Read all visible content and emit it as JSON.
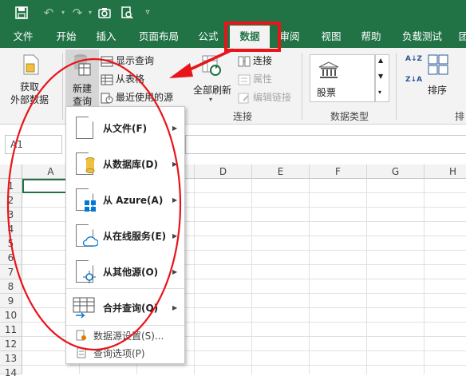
{
  "titlebar": {
    "save_icon": "save-icon",
    "undo_icon": "undo-icon",
    "redo_icon": "redo-icon",
    "camera_icon": "camera-icon",
    "print_preview_icon": "print-preview-icon",
    "customize_icon": "customize-quick-access-icon"
  },
  "tabs": [
    "文件",
    "开始",
    "插入",
    "页面布局",
    "公式",
    "数据",
    "审阅",
    "视图",
    "帮助",
    "负载测试",
    "团"
  ],
  "active_tab": "数据",
  "ribbon": {
    "get_external_data": {
      "line1": "获取",
      "line2": "外部数据"
    },
    "new_query": {
      "line1": "新建",
      "line2": "查询"
    },
    "show_queries": "显示查询",
    "from_table": "从表格",
    "recent_sources": "最近使用的源",
    "refresh_all": "全部刷新",
    "connections": "连接",
    "properties": "属性",
    "edit_links": "编辑链接",
    "connections_group": "连接",
    "stock": "股票",
    "data_types_group": "数据类型",
    "sort": "排序",
    "sort_az": "A↓Z",
    "sort_za": "Z↓A",
    "group_partial": "排"
  },
  "formula_bar": {
    "name_box": "A1"
  },
  "columns": [
    "A",
    "B",
    "C",
    "D",
    "E",
    "F",
    "G",
    "H"
  ],
  "rows": [
    "1",
    "2",
    "3",
    "4",
    "5",
    "6",
    "7",
    "8",
    "9",
    "10",
    "11",
    "12",
    "13",
    "14"
  ],
  "menu": {
    "items": [
      "从文件(F)",
      "从数据库(D)",
      "从 Azure(A)",
      "从在线服务(E)",
      "从其他源(O)",
      "合并查询(Q)"
    ],
    "settings": "数据源设置(S)...",
    "options": "查询选项(P)"
  },
  "colors": {
    "excel_green": "#217346",
    "annotation_red": "#e8141a"
  }
}
